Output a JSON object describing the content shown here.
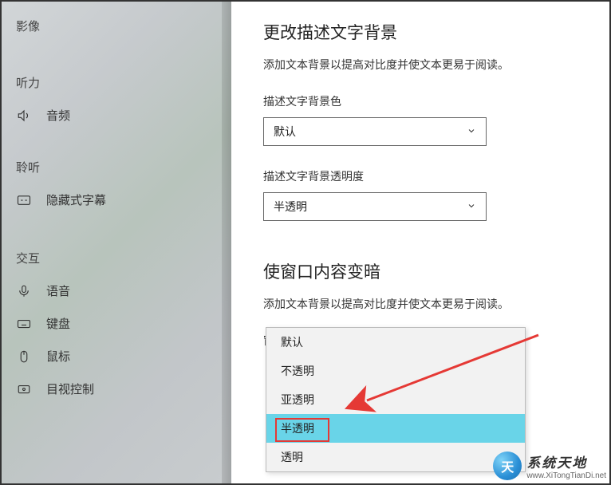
{
  "sidebar": {
    "sections": [
      {
        "label": "影像"
      },
      {
        "label": "听力"
      },
      {
        "label": "聆听"
      },
      {
        "label": "交互"
      }
    ],
    "items": {
      "audio": "音频",
      "captions": "隐藏式字幕",
      "speech": "语音",
      "keyboard": "键盘",
      "mouse": "鼠标",
      "eye_control": "目视控制"
    }
  },
  "main": {
    "section1": {
      "title": "更改描述文字背景",
      "desc": "添加文本背景以提高对比度并使文本更易于阅读。",
      "field1_label": "描述文字背景色",
      "field1_value": "默认",
      "field2_label": "描述文字背景透明度",
      "field2_value": "半透明"
    },
    "section2": {
      "title": "使窗口内容变暗",
      "desc": "添加文本背景以提高对比度并使文本更易于阅读。",
      "field_label": "窗口颜色"
    },
    "dropdown": {
      "options": [
        "默认",
        "不透明",
        "亚透明",
        "半透明",
        "透明"
      ]
    }
  },
  "watermark": {
    "cn": "系统天地",
    "domain": "www.XiTongTianDi.net",
    "orb": "天"
  }
}
